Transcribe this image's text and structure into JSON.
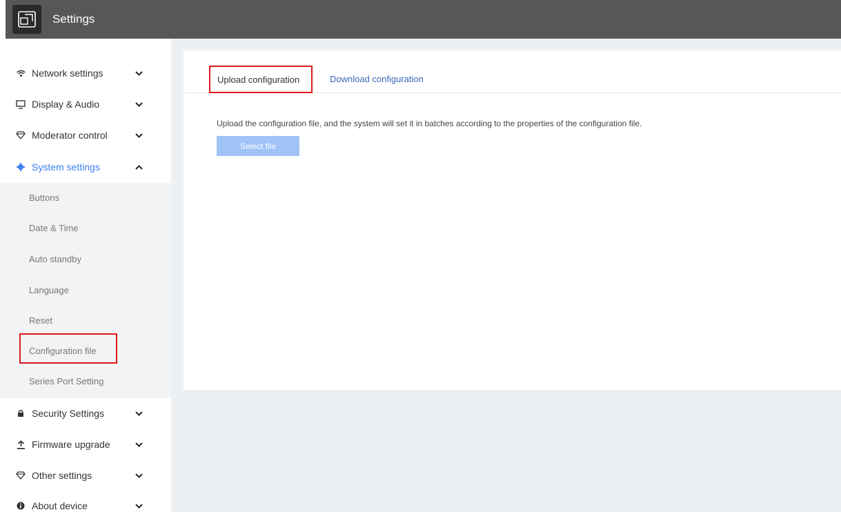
{
  "app": {
    "title": "Settings"
  },
  "sidebar": {
    "items_top": [
      {
        "label": "Network settings",
        "icon": "wifi-icon"
      },
      {
        "label": "Display & Audio",
        "icon": "monitor-icon"
      },
      {
        "label": "Moderator control",
        "icon": "diamond-icon"
      },
      {
        "label": "System settings",
        "icon": "gear-icon",
        "expanded": true
      }
    ],
    "sub_items": [
      {
        "label": "Buttons"
      },
      {
        "label": "Date & Time"
      },
      {
        "label": "Auto standby"
      },
      {
        "label": "Language"
      },
      {
        "label": "Reset"
      },
      {
        "label": "Configuration file",
        "selected": true
      },
      {
        "label": "Series Port Setting"
      }
    ],
    "items_bottom": [
      {
        "label": "Security Settings",
        "icon": "lock-icon"
      },
      {
        "label": "Firmware upgrade",
        "icon": "upload-icon"
      },
      {
        "label": "Other settings",
        "icon": "diamond-icon"
      },
      {
        "label": "About device",
        "icon": "info-icon"
      }
    ]
  },
  "main": {
    "tabs": [
      {
        "label": "Upload configuration",
        "active": true
      },
      {
        "label": "Download configuration"
      }
    ],
    "description": "Upload the configuration file, and the system will set it in batches according to the properties of the configuration file.",
    "select_button_label": "Select file"
  },
  "colors": {
    "accent": "#3a7ff0",
    "highlight_border": "#e0161c",
    "topbar": "#575757",
    "button_disabled": "#9fc2f7"
  }
}
